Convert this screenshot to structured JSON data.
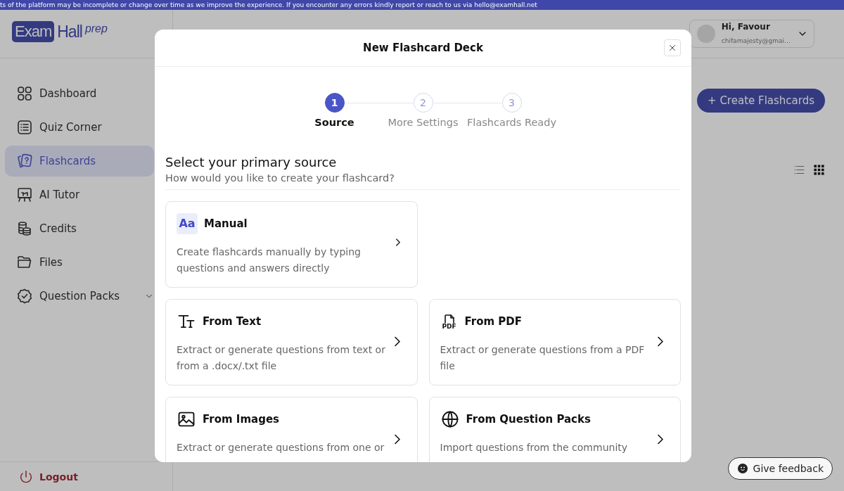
{
  "banner": {
    "text": "ts of the platform may be incomplete or change over time as we improve the experience. If you encounter any errors kindly report or reach to us via hello@examhall.net"
  },
  "logo": {
    "badge": "Exam",
    "word": "Hall",
    "suffix": "prep"
  },
  "user": {
    "greeting": "Hi, Favour",
    "email": "chifamajesty@gmai…"
  },
  "sidebar": {
    "items": [
      {
        "kind": "dashboard",
        "label": "Dashboard",
        "selected": false
      },
      {
        "kind": "quiz",
        "label": "Quiz Corner",
        "selected": false
      },
      {
        "kind": "flashcards",
        "label": "Flashcards",
        "selected": true
      },
      {
        "kind": "tutor",
        "label": "AI Tutor",
        "selected": false
      },
      {
        "kind": "credits",
        "label": "Credits",
        "selected": false
      },
      {
        "kind": "files",
        "label": "Files",
        "selected": false
      },
      {
        "kind": "packs",
        "label": "Question Packs",
        "selected": false,
        "expanded": false
      }
    ],
    "logout": "Logout"
  },
  "toolbar": {
    "create_button": "+ Create Flashcards",
    "views": [
      {
        "kind": "list",
        "selected": false
      },
      {
        "kind": "grid",
        "selected": true
      }
    ]
  },
  "modal": {
    "title": "New Flashcard Deck",
    "steps": [
      {
        "number": "1",
        "label": "Source",
        "selected": true
      },
      {
        "number": "2",
        "label": "More Settings",
        "selected": false
      },
      {
        "number": "3",
        "label": "Flashcards Ready",
        "selected": false
      }
    ],
    "heading": "Select your primary source",
    "subheading": "How would you like to create your flashcard?",
    "sources": [
      {
        "kind": "manual",
        "icon_text": "Aa",
        "title": "Manual",
        "description": "Create flashcards manually by typing questions and answers directly"
      },
      {
        "kind": "text",
        "title": "From Text",
        "description": "Extract or generate questions from text or from a .docx/.txt file"
      },
      {
        "kind": "pdf",
        "icon_text": "PDF",
        "title": "From PDF",
        "description": "Extract or generate questions from a PDF file"
      },
      {
        "kind": "images",
        "title": "From Images",
        "description": "Extract or generate questions from one or"
      },
      {
        "kind": "packs",
        "title": "From Question Packs",
        "description": "Import questions from the community"
      }
    ]
  },
  "feedback_button": "Give feedback"
}
